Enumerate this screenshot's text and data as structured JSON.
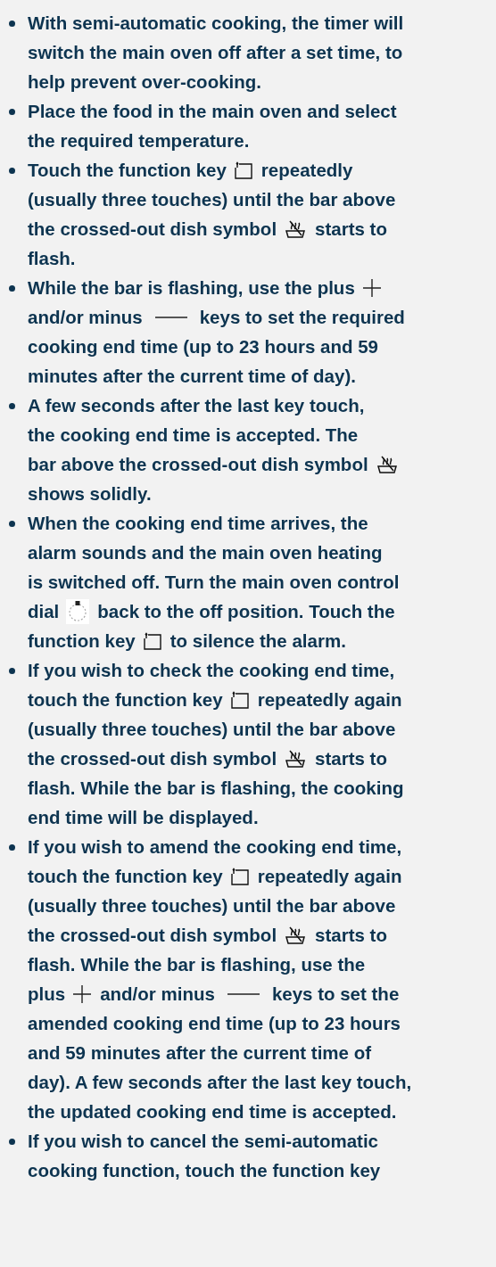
{
  "items": [
    {
      "lines": [
        [
          {
            "kind": "text",
            "text": "With semi-automatic cooking, the timer will"
          }
        ],
        [
          {
            "kind": "text",
            "text": "switch the main oven off after a set time, to"
          }
        ],
        [
          {
            "kind": "text",
            "text": "help prevent over-cooking."
          }
        ]
      ]
    },
    {
      "lines": [
        [
          {
            "kind": "text",
            "text": "Place the food in the main oven and select"
          }
        ],
        [
          {
            "kind": "text",
            "text": "the required temperature."
          }
        ]
      ]
    },
    {
      "lines": [
        [
          {
            "kind": "text",
            "text": "Touch the function key"
          },
          {
            "kind": "function_key"
          },
          {
            "kind": "text",
            "text": "repeatedly"
          }
        ],
        [
          {
            "kind": "text",
            "text": "(usually three touches) until the bar above"
          }
        ],
        [
          {
            "kind": "text",
            "text": "the crossed-out dish symbol"
          },
          {
            "kind": "dish"
          },
          {
            "kind": "text",
            "text": "starts to"
          }
        ],
        [
          {
            "kind": "text",
            "text": "flash."
          }
        ]
      ]
    },
    {
      "lines": [
        [
          {
            "kind": "text",
            "text": "While the bar is flashing, use the plus"
          },
          {
            "kind": "plus"
          }
        ],
        [
          {
            "kind": "text",
            "text": "and/or minus"
          },
          {
            "kind": "minus"
          },
          {
            "kind": "text",
            "text": "keys to set the required"
          }
        ],
        [
          {
            "kind": "text",
            "text": "cooking end time (up to 23 hours and 59"
          }
        ],
        [
          {
            "kind": "text",
            "text": "minutes after the current time of day)."
          }
        ]
      ]
    },
    {
      "lines": [
        [
          {
            "kind": "text",
            "text": "A few seconds after the last key touch,"
          }
        ],
        [
          {
            "kind": "text",
            "text": "the cooking end time is accepted. The"
          }
        ],
        [
          {
            "kind": "text",
            "text": "bar above the crossed-out dish symbol"
          },
          {
            "kind": "dish"
          }
        ],
        [
          {
            "kind": "text",
            "text": "shows solidly."
          }
        ]
      ]
    },
    {
      "lines": [
        [
          {
            "kind": "text",
            "text": "When the cooking end time arrives, the"
          }
        ],
        [
          {
            "kind": "text",
            "text": "alarm sounds and the main oven heating"
          }
        ],
        [
          {
            "kind": "text",
            "text": "is switched off. Turn the main oven control"
          }
        ],
        [
          {
            "kind": "text",
            "text": "dial"
          },
          {
            "kind": "dial"
          },
          {
            "kind": "text",
            "text": "back to the off position. Touch the"
          }
        ],
        [
          {
            "kind": "text",
            "text": "function key"
          },
          {
            "kind": "function_key"
          },
          {
            "kind": "text",
            "text": "to silence the alarm."
          }
        ]
      ]
    },
    {
      "lines": [
        [
          {
            "kind": "text",
            "text": "If you wish to check the cooking end time,"
          }
        ],
        [
          {
            "kind": "text",
            "text": "touch the function key"
          },
          {
            "kind": "function_key"
          },
          {
            "kind": "text",
            "text": "repeatedly again"
          }
        ],
        [
          {
            "kind": "text",
            "text": "(usually three touches) until the bar above"
          }
        ],
        [
          {
            "kind": "text",
            "text": "the crossed-out dish symbol"
          },
          {
            "kind": "dish"
          },
          {
            "kind": "text",
            "text": "starts to"
          }
        ],
        [
          {
            "kind": "text",
            "text": "flash. While the bar is flashing, the cooking"
          }
        ],
        [
          {
            "kind": "text",
            "text": "end time will be displayed."
          }
        ]
      ]
    },
    {
      "lines": [
        [
          {
            "kind": "text",
            "text": "If you wish to amend the cooking end time,"
          }
        ],
        [
          {
            "kind": "text",
            "text": "touch the function key"
          },
          {
            "kind": "function_key"
          },
          {
            "kind": "text",
            "text": "repeatedly again"
          }
        ],
        [
          {
            "kind": "text",
            "text": "(usually three touches) until the bar above"
          }
        ],
        [
          {
            "kind": "text",
            "text": "the crossed-out dish symbol"
          },
          {
            "kind": "dish"
          },
          {
            "kind": "text",
            "text": "starts to"
          }
        ],
        [
          {
            "kind": "text",
            "text": "flash. While the bar is flashing, use the"
          }
        ],
        [
          {
            "kind": "text",
            "text": "plus"
          },
          {
            "kind": "plus"
          },
          {
            "kind": "text",
            "text": "and/or minus"
          },
          {
            "kind": "minus"
          },
          {
            "kind": "text",
            "text": "keys to set the"
          }
        ],
        [
          {
            "kind": "text",
            "text": "amended cooking end time (up to 23 hours"
          }
        ],
        [
          {
            "kind": "text",
            "text": "and 59 minutes after the current time of"
          }
        ],
        [
          {
            "kind": "text",
            "text": "day). A few seconds after the last key touch,"
          }
        ],
        [
          {
            "kind": "text",
            "text": "the updated cooking end time is accepted."
          }
        ]
      ]
    },
    {
      "lines": [
        [
          {
            "kind": "text",
            "text": "If you wish to cancel the semi-automatic"
          }
        ],
        [
          {
            "kind": "text",
            "text": "cooking function, touch the function key"
          }
        ]
      ]
    }
  ]
}
